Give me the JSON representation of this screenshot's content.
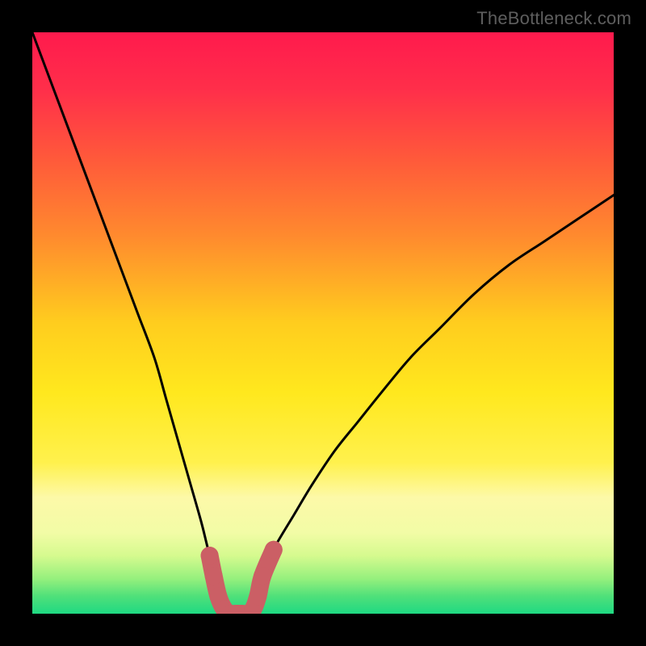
{
  "watermark": "TheBottleneck.com",
  "colors": {
    "frame": "#000000",
    "watermark": "#5e5e5e",
    "curve": "#000000",
    "marker_fill": "#cb5f65",
    "marker_stroke": "#cb5f65"
  },
  "gradient_stops": [
    {
      "offset": 0.0,
      "color": "#ff1a4d"
    },
    {
      "offset": 0.1,
      "color": "#ff2f4a"
    },
    {
      "offset": 0.22,
      "color": "#ff5a3a"
    },
    {
      "offset": 0.35,
      "color": "#ff8a2e"
    },
    {
      "offset": 0.5,
      "color": "#ffcd1e"
    },
    {
      "offset": 0.62,
      "color": "#ffe81e"
    },
    {
      "offset": 0.74,
      "color": "#fff14d"
    },
    {
      "offset": 0.8,
      "color": "#fdf9a8"
    },
    {
      "offset": 0.86,
      "color": "#f2fca6"
    },
    {
      "offset": 0.9,
      "color": "#d6fa8f"
    },
    {
      "offset": 0.94,
      "color": "#95f07d"
    },
    {
      "offset": 0.97,
      "color": "#4fe07a"
    },
    {
      "offset": 1.0,
      "color": "#1fd982"
    }
  ],
  "chart_data": {
    "type": "line",
    "title": "",
    "xlabel": "",
    "ylabel": "",
    "xlim": [
      0,
      100
    ],
    "ylim": [
      0,
      100
    ],
    "series": [
      {
        "name": "bottleneck-curve",
        "x": [
          0,
          3,
          6,
          9,
          12,
          15,
          18,
          21,
          23,
          25,
          27,
          29,
          30,
          31,
          32,
          33,
          34,
          35,
          36,
          37,
          38,
          40,
          42,
          45,
          48,
          52,
          56,
          60,
          65,
          70,
          76,
          82,
          88,
          94,
          100
        ],
        "y": [
          100,
          92,
          84,
          76,
          68,
          60,
          52,
          44,
          37,
          30,
          23,
          16,
          12,
          8,
          4,
          1,
          0,
          0,
          0,
          1,
          4,
          8,
          12,
          17,
          22,
          28,
          33,
          38,
          44,
          49,
          55,
          60,
          64,
          68,
          72
        ]
      }
    ],
    "markers": {
      "name": "optimal-range",
      "x": [
        30.5,
        31.2,
        32.0,
        33.0,
        34.0,
        35.0,
        36.0,
        37.0,
        38.0,
        38.8,
        39.6,
        41.5
      ],
      "y": [
        10.0,
        6.5,
        3.0,
        0.8,
        0.0,
        0.0,
        0.0,
        0.0,
        0.8,
        3.0,
        6.5,
        11.0
      ],
      "style": "thick-rounded"
    }
  }
}
